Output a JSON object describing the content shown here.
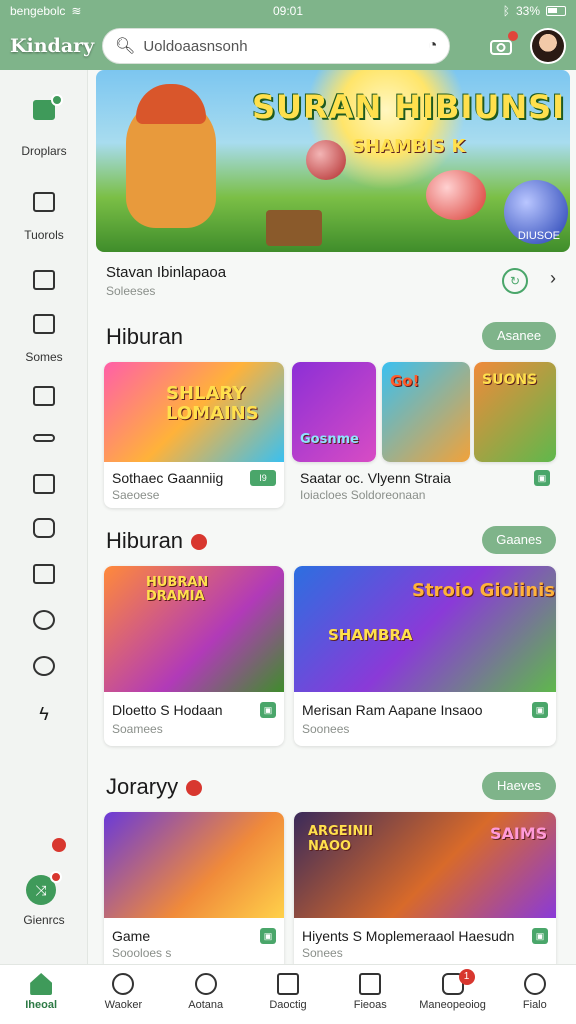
{
  "status": {
    "carrier": "bengebolc",
    "time": "09:01",
    "battery": "33%"
  },
  "app": {
    "title": "Kindary"
  },
  "search": {
    "value": "Uoldoaasnsonh"
  },
  "sidebar": {
    "items": [
      {
        "label": "Droplars",
        "icon": "controller-icon"
      },
      {
        "label": "Tuorols",
        "icon": "monitor-icon"
      },
      {
        "label": "",
        "icon": "puzzle-icon"
      },
      {
        "label": "Somes",
        "icon": "tv-icon"
      },
      {
        "label": "",
        "icon": "card-icon"
      },
      {
        "label": "",
        "icon": "key-icon"
      },
      {
        "label": "",
        "icon": "list-icon"
      },
      {
        "label": "",
        "icon": "shield-icon"
      },
      {
        "label": "",
        "icon": "bookmark-icon"
      },
      {
        "label": "",
        "icon": "clock-icon"
      },
      {
        "label": "",
        "icon": "search-icon"
      },
      {
        "label": "",
        "icon": "lightning-icon"
      }
    ],
    "genre_label": "Gienrcs"
  },
  "hero": {
    "banner_title": "SURAN HIBIUNSI",
    "banner_subtitle": "SHAMBIS K",
    "banner_tag": "DIUSOE",
    "title": "Stavan Ibinlapaoa",
    "subtitle": "Soleeses"
  },
  "sections": [
    {
      "heading": "Hiburan",
      "button": "Asanee",
      "cards": [
        {
          "art_title": "SHLARY LOMAINS",
          "title": "Sothaec Gaanniig",
          "subtitle": "Saeoese",
          "tag": "I9"
        },
        {
          "art_title": "Gosnme",
          "title": "",
          "subtitle": "",
          "tag": ""
        },
        {
          "art_title": "Go!",
          "title": "Saatar oc. Vlyenn Straia",
          "subtitle": "Ioiacloes Soldoreonaan",
          "tag": ""
        },
        {
          "art_title": "SUONS",
          "title": "",
          "subtitle": "",
          "tag": ""
        }
      ]
    },
    {
      "heading": "Hiburan",
      "button": "Gaanes",
      "cards": [
        {
          "art_title": "HUBRAN DRAMIA",
          "title": "Dloetto S Hodaan",
          "subtitle": "Soamees",
          "tag": "F"
        },
        {
          "art_title": "Stroio Gioiinis",
          "title": "Merisan Ram Aapane Insaoo",
          "subtitle": "Soonees",
          "tag": "SHAMBRA"
        }
      ]
    },
    {
      "heading": "Joraryy",
      "button": "Haeves",
      "cards": [
        {
          "art_title": "",
          "title": "Game",
          "subtitle": "Soooloes s",
          "tag": ""
        },
        {
          "art_title": "SAIMS",
          "title": "Hiyents S Moplemeraaol Haesudn",
          "subtitle": "Sonees",
          "tag": "ARGEINII NAOO"
        }
      ]
    }
  ],
  "bottom_nav": [
    {
      "label": "Iheoal",
      "icon": "home-icon",
      "active": true
    },
    {
      "label": "Waoker",
      "icon": "search-icon",
      "active": false
    },
    {
      "label": "Aotana",
      "icon": "compass-icon",
      "active": false
    },
    {
      "label": "Daoctig",
      "icon": "calendar-icon",
      "active": false
    },
    {
      "label": "Fieoas",
      "icon": "edit-icon",
      "active": false
    },
    {
      "label": "Maneopeoiog",
      "icon": "gamepad-icon",
      "active": false,
      "badge": "1"
    },
    {
      "label": "Fialo",
      "icon": "profile-icon",
      "active": false
    }
  ],
  "colors": {
    "accent": "#7fb48a",
    "primary": "#3f9a5a",
    "alert": "#d8372f"
  }
}
